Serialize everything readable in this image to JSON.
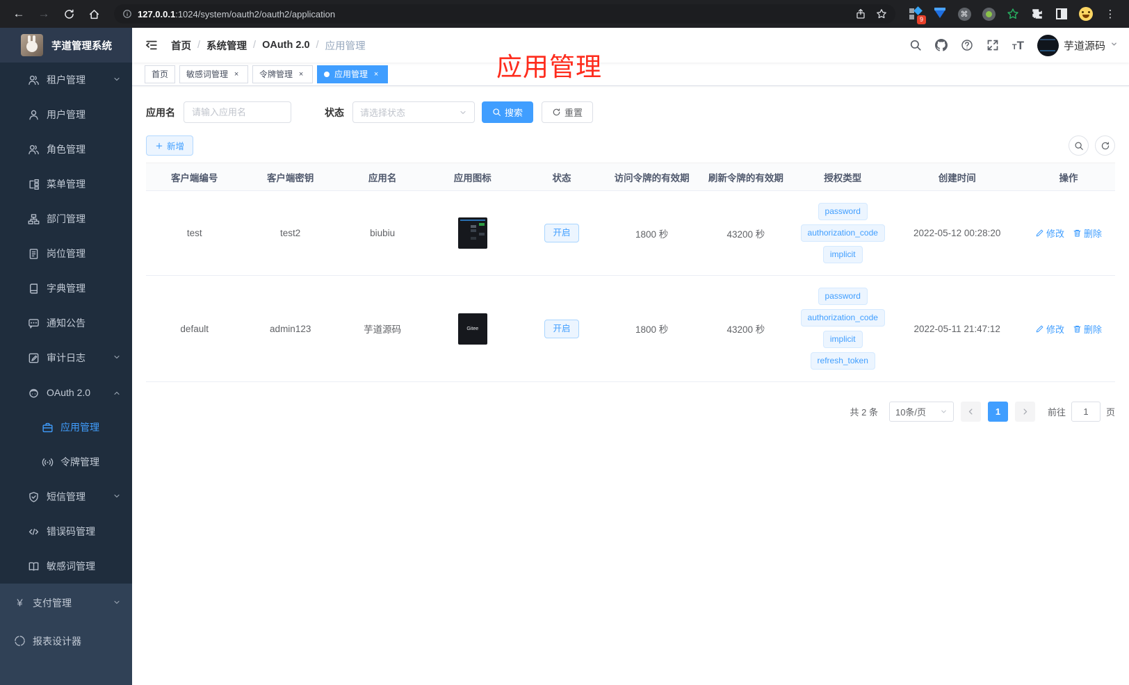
{
  "colors": {
    "accent": "#409eff",
    "annotation_red": "#fe2b1c",
    "sidebar_dark": "#1f2d3d",
    "sidebar_light": "#304156"
  },
  "browser": {
    "url_host": "127.0.0.1",
    "url_rest": ":1024/system/oauth2/oauth2/application",
    "back_glyph": "←",
    "forward_glyph": "→",
    "menu_dots": "⋮",
    "command_glyph": "⌘",
    "ext_badge_count": "9"
  },
  "sidebar": {
    "logo_title": "芋道管理系统",
    "items": [
      {
        "label": "租户管理"
      },
      {
        "label": "用户管理"
      },
      {
        "label": "角色管理"
      },
      {
        "label": "菜单管理"
      },
      {
        "label": "部门管理"
      },
      {
        "label": "岗位管理"
      },
      {
        "label": "字典管理"
      },
      {
        "label": "通知公告"
      },
      {
        "label": "审计日志"
      },
      {
        "label": "OAuth 2.0"
      },
      {
        "label": "应用管理"
      },
      {
        "label": "令牌管理"
      },
      {
        "label": "短信管理"
      },
      {
        "label": "错误码管理"
      },
      {
        "label": "敏感词管理"
      },
      {
        "label": "支付管理"
      },
      {
        "label": "报表设计器"
      }
    ]
  },
  "navbar": {
    "breadcrumb": [
      "首页",
      "系统管理",
      "OAuth 2.0",
      "应用管理"
    ],
    "separator": "/",
    "username": "芋道源码"
  },
  "tags": [
    {
      "label": "首页"
    },
    {
      "label": "敏感词管理",
      "close": "×"
    },
    {
      "label": "令牌管理",
      "close": "×"
    },
    {
      "label": "应用管理",
      "close": "×"
    }
  ],
  "annotation": "应用管理",
  "filter": {
    "name_label": "应用名",
    "name_placeholder": "请输入应用名",
    "status_label": "状态",
    "status_placeholder": "请选择状态",
    "search_label": "搜索",
    "reset_label": "重置"
  },
  "toolbar": {
    "add_label": "新增"
  },
  "ops": {
    "edit_label": "修改",
    "delete_label": "删除"
  },
  "table": {
    "headers": [
      "客户端编号",
      "客户端密钥",
      "应用名",
      "应用图标",
      "状态",
      "访问令牌的有效期",
      "刷新令牌的有效期",
      "授权类型",
      "创建时间",
      "操作"
    ],
    "rows": [
      {
        "client_id": "test",
        "secret": "test2",
        "name": "biubiu",
        "status": "开启",
        "access_ttl": "1800 秒",
        "refresh_ttl": "43200 秒",
        "grants": [
          "password",
          "authorization_code",
          "implicit"
        ],
        "created": "2022-05-12 00:28:20"
      },
      {
        "client_id": "default",
        "secret": "admin123",
        "name": "芋道源码",
        "icon_text": "Gitee",
        "status": "开启",
        "access_ttl": "1800 秒",
        "refresh_ttl": "43200 秒",
        "grants": [
          "password",
          "authorization_code",
          "implicit",
          "refresh_token"
        ],
        "created": "2022-05-11 21:47:12"
      }
    ]
  },
  "pagination": {
    "total": "共 2 条",
    "page_size": "10条/页",
    "page": "1",
    "goto_prefix": "前往",
    "goto_value": "1",
    "goto_suffix": "页"
  }
}
